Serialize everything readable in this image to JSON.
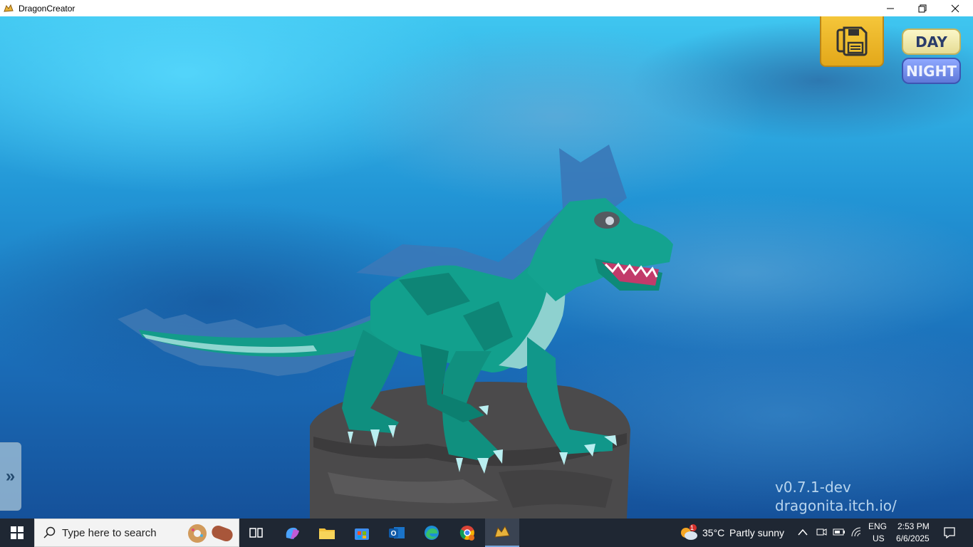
{
  "window": {
    "title": "DragonCreator"
  },
  "game": {
    "day_label": "DAY",
    "night_label": "NIGHT",
    "side_tab_label": "»",
    "version": "v0.7.1-dev",
    "website": "dragonita.itch.io/"
  },
  "taskbar": {
    "search_placeholder": "Type here to search",
    "weather_temp": "35°C",
    "weather_desc": "Partly sunny",
    "weather_badge": "1",
    "language_top": "ENG",
    "language_bottom": "US",
    "time": "2:53 PM",
    "date": "6/6/2025",
    "pinned_apps": [
      "task-view",
      "copilot",
      "file-explorer",
      "microsoft-store",
      "outlook",
      "edge",
      "chrome",
      "dragon-creator"
    ]
  },
  "colors": {
    "save_button": "#f0bc2e",
    "day_button": "#f4efb8",
    "night_button": "#7a93f0",
    "dragon_body": "#13a08e",
    "dragon_fin": "#3a7fc0",
    "rock": "#4a4a4a"
  }
}
